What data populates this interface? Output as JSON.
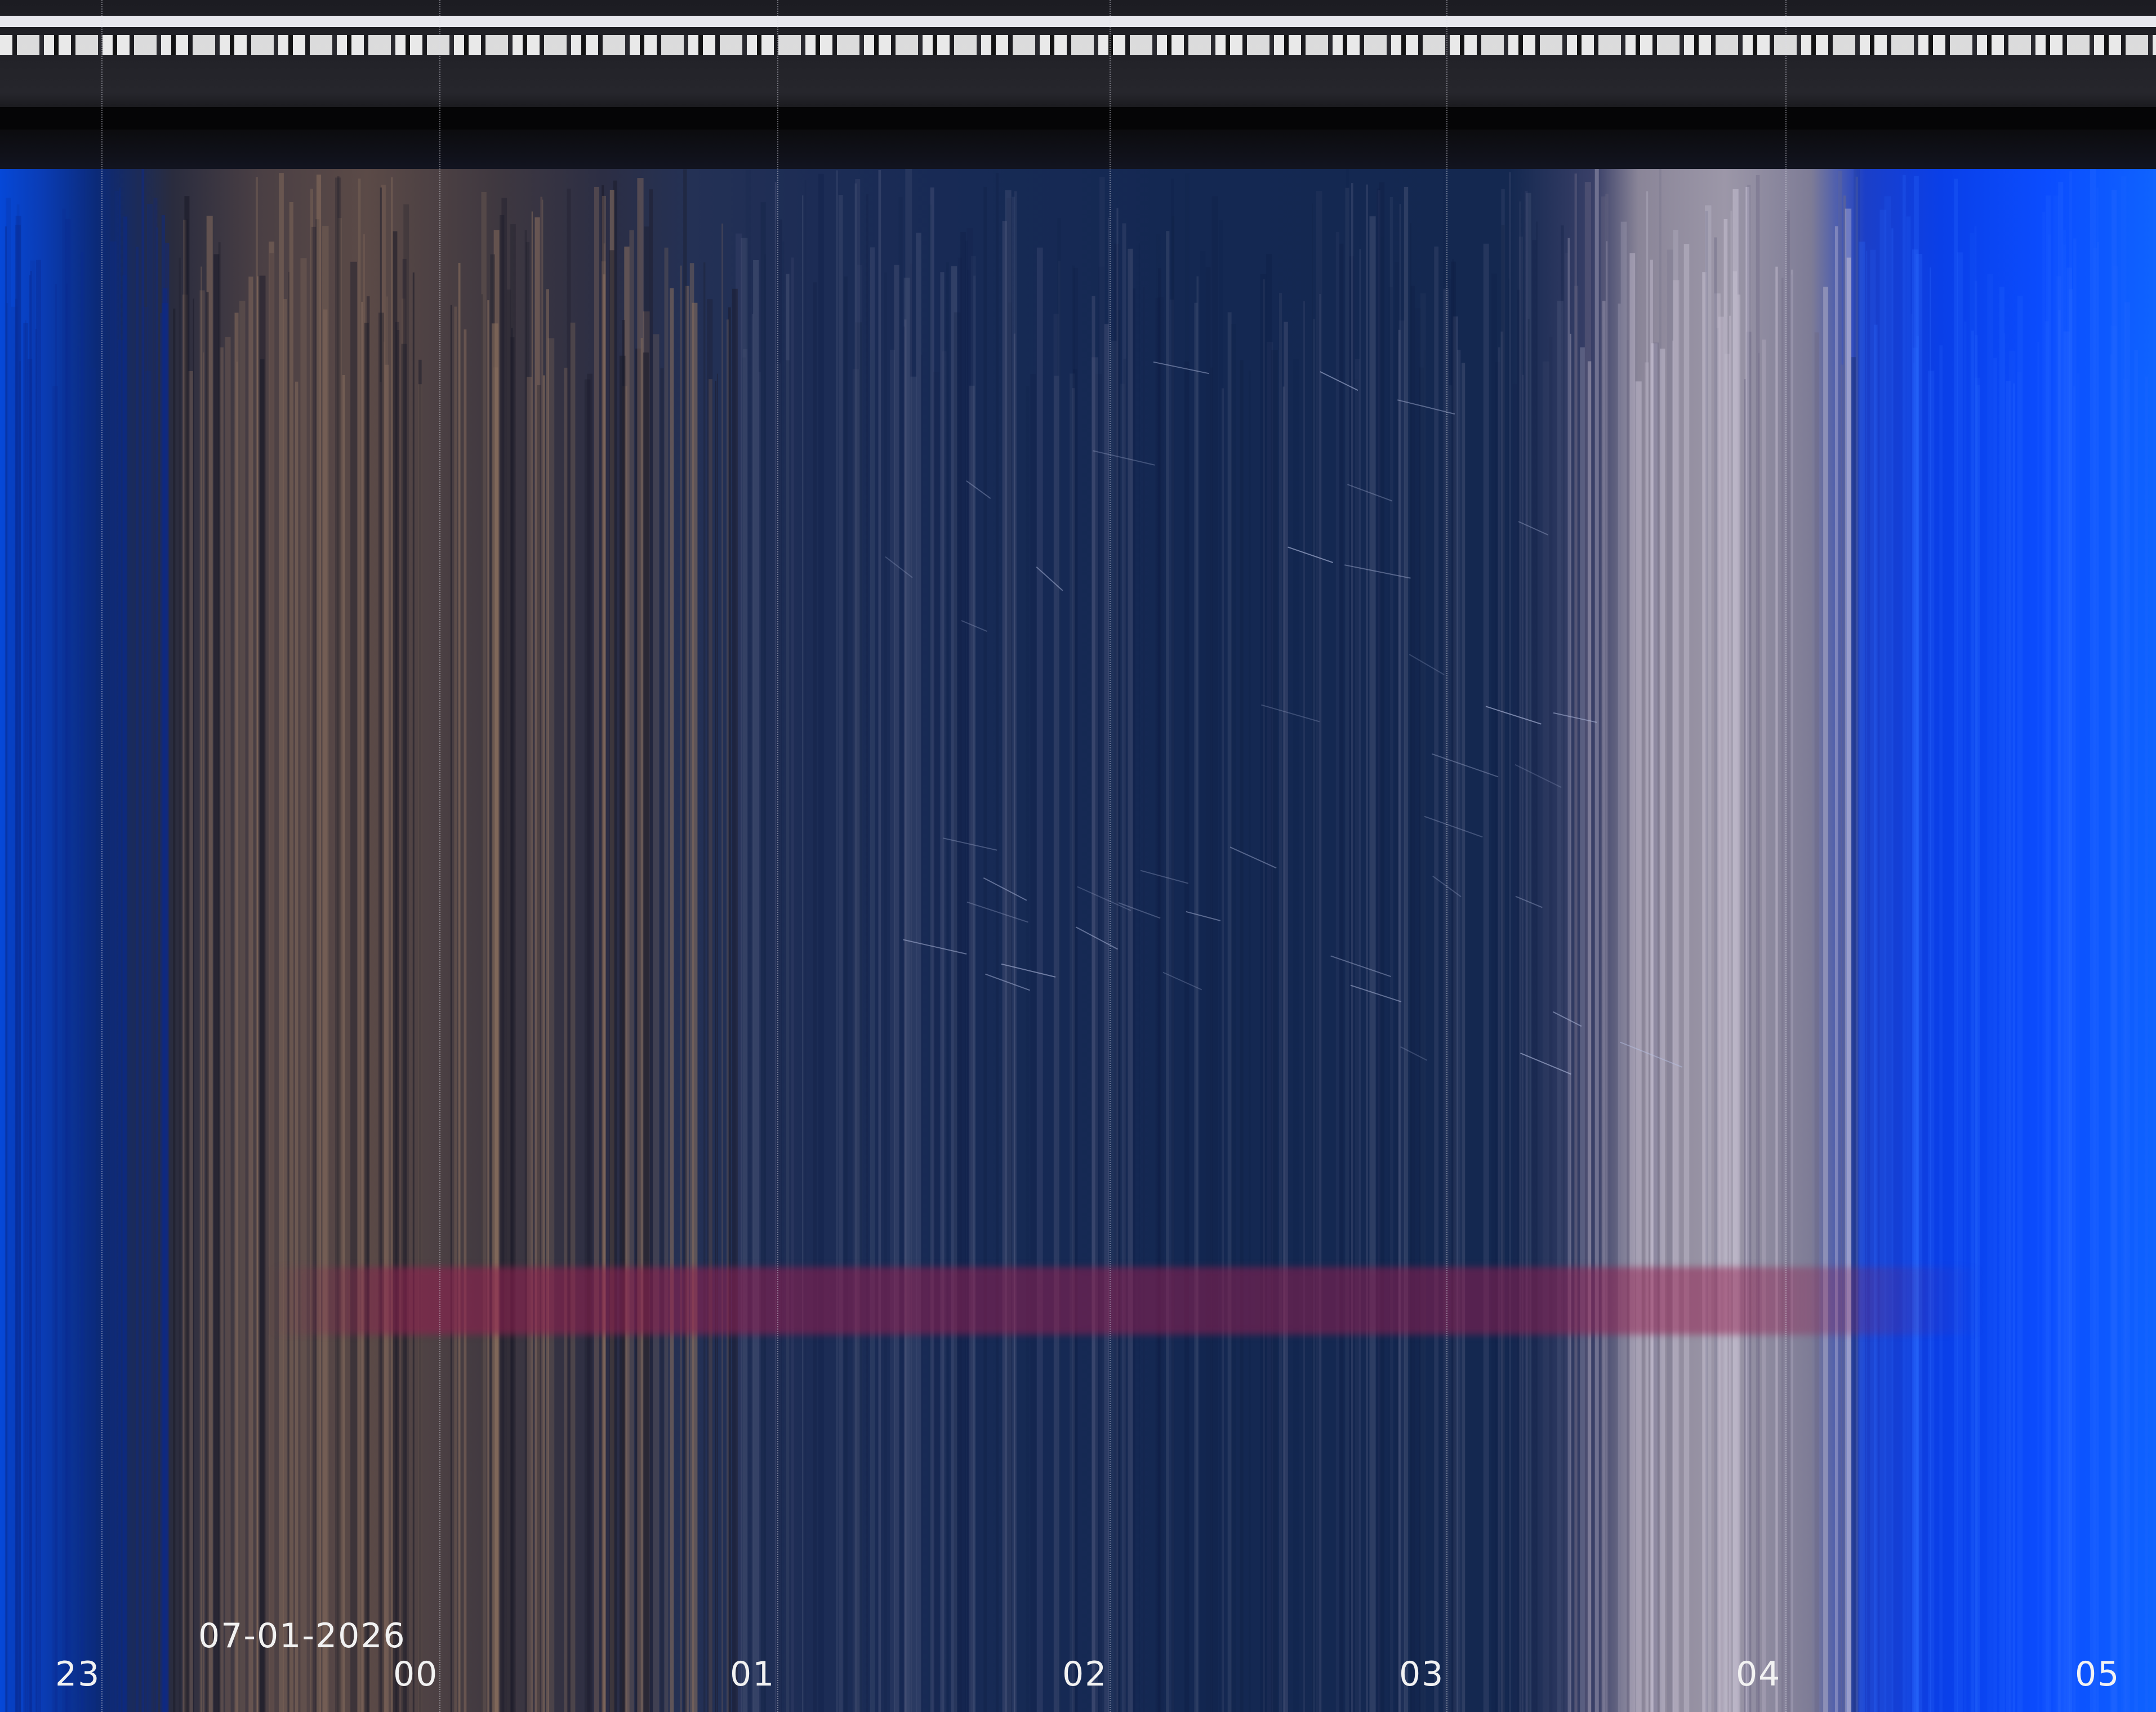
{
  "timeline": {
    "date": "07-01-2026",
    "hour_ticks": [
      "23",
      "00",
      "01",
      "02",
      "03",
      "04",
      "05"
    ]
  },
  "colors": {
    "sky_dark": "#142852",
    "sky_bright_blue": "#0b4dff",
    "light_pollution_band": "#9c97a8",
    "warm_band": "#5b4a47",
    "red_band": "#961e50",
    "label_text": "#f2f2f2"
  }
}
